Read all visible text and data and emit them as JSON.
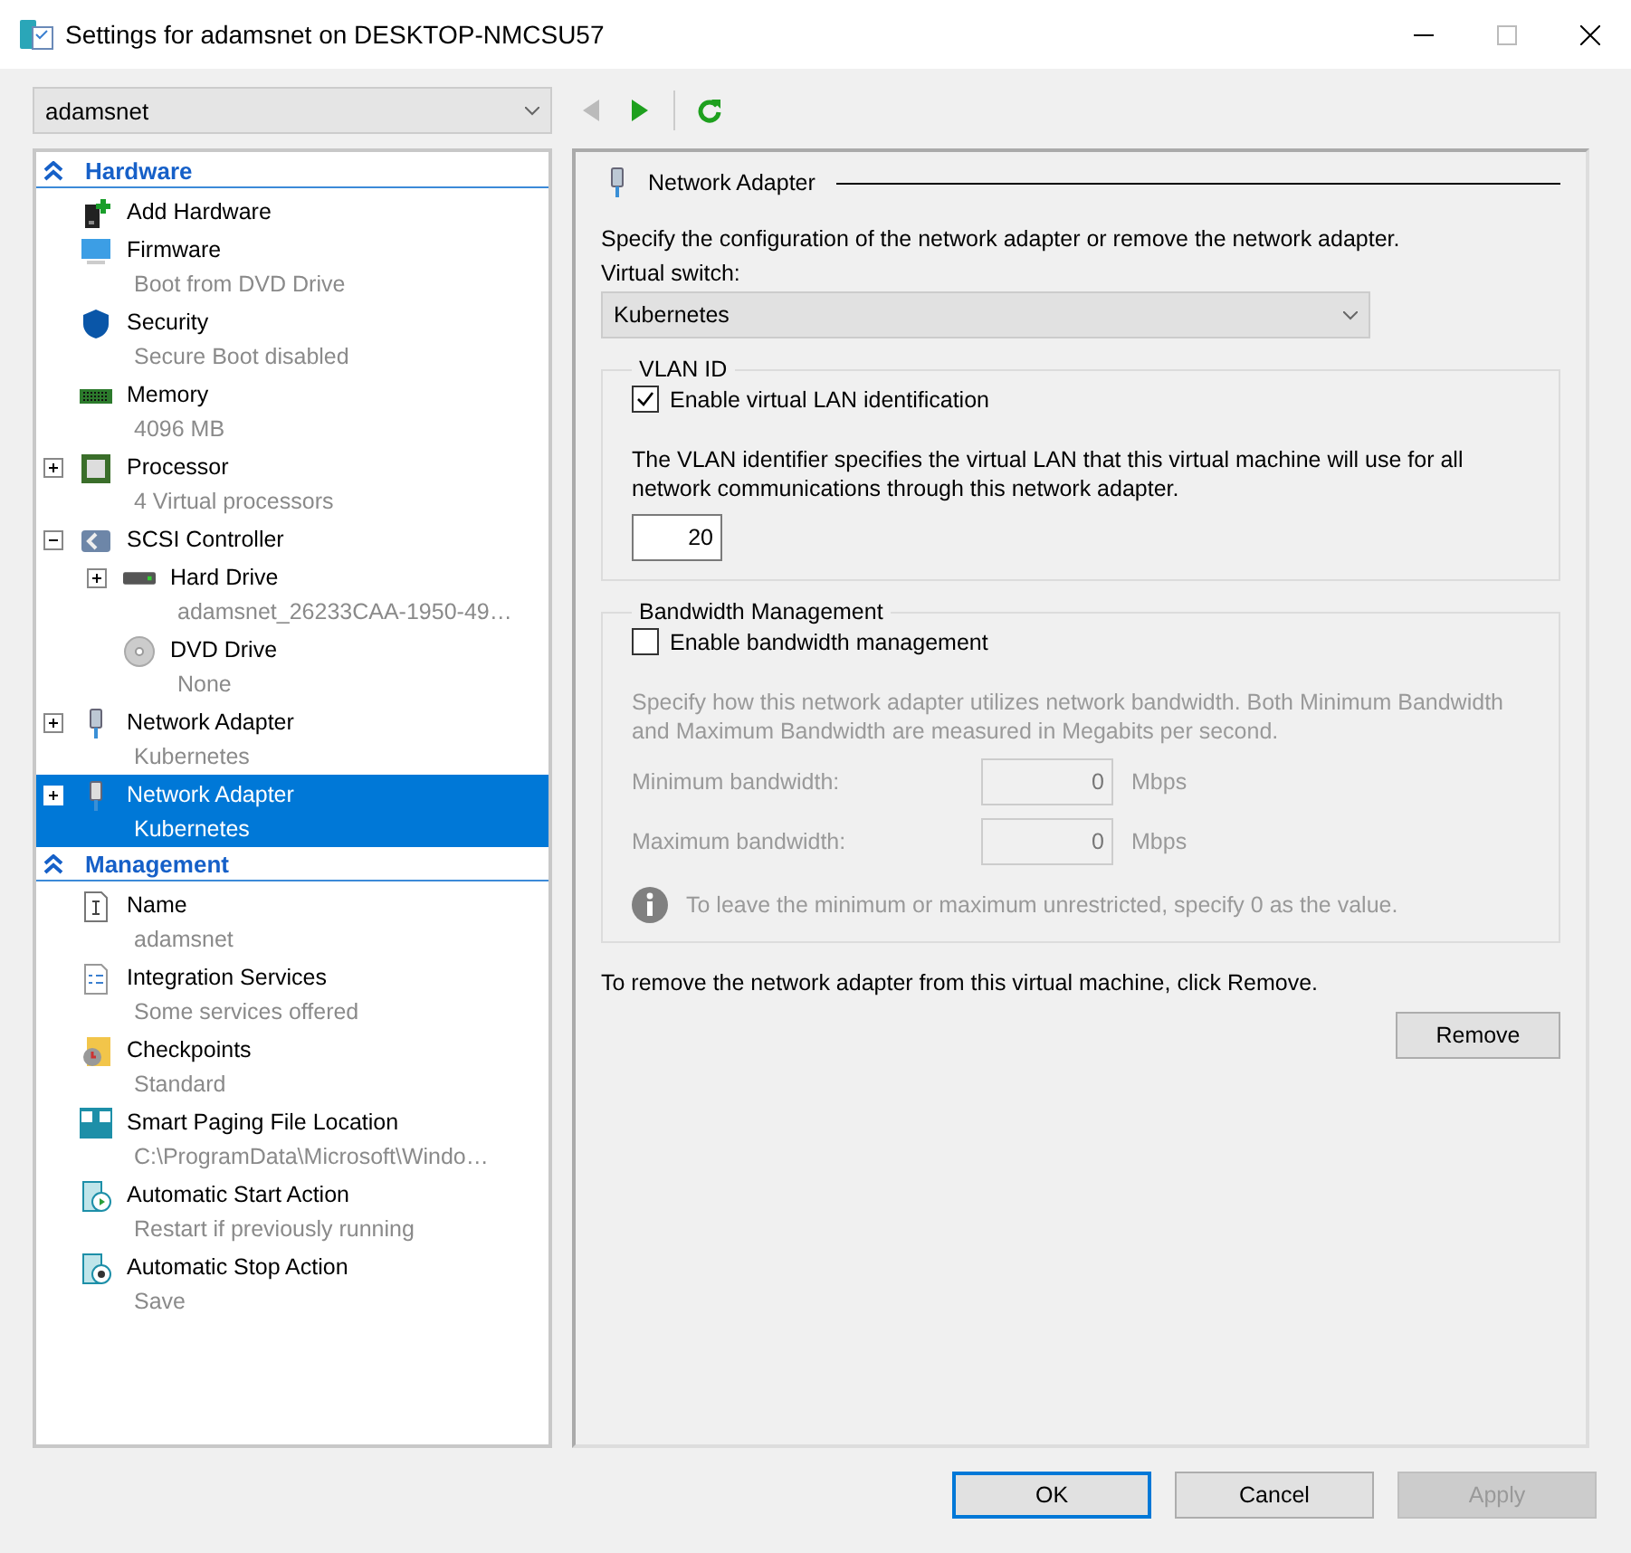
{
  "window": {
    "title": "Settings for adamsnet on DESKTOP-NMCSU57"
  },
  "vm_selector": {
    "value": "adamsnet"
  },
  "tree": [
    {
      "title": "Hardware",
      "items": [
        {
          "name": "Add Hardware",
          "kind": "add-hardware",
          "selected": false
        },
        {
          "name": "Firmware",
          "detail": "Boot from DVD Drive",
          "kind": "firmware",
          "selected": false
        },
        {
          "name": "Security",
          "detail": "Secure Boot disabled",
          "kind": "security",
          "selected": false
        },
        {
          "name": "Memory",
          "detail": "4096 MB",
          "kind": "memory",
          "selected": false
        },
        {
          "name": "Processor",
          "detail": "4 Virtual processors",
          "kind": "processor",
          "expanded": false,
          "selected": false
        },
        {
          "name": "SCSI Controller",
          "kind": "controller",
          "expanded": true,
          "selected": false,
          "children": [
            {
              "name": "Hard Drive",
              "detail": "adamsnet_26233CAA-1950-49…",
              "kind": "disk",
              "expanded": false,
              "selected": false
            },
            {
              "name": "DVD Drive",
              "detail": "None",
              "kind": "dvd",
              "selected": false
            }
          ]
        },
        {
          "name": "Network Adapter",
          "detail": "Kubernetes",
          "kind": "network",
          "expanded": false,
          "selected": false
        },
        {
          "name": "Network Adapter",
          "detail": "Kubernetes",
          "kind": "network",
          "expanded": false,
          "selected": true
        }
      ]
    },
    {
      "title": "Management",
      "items": [
        {
          "name": "Name",
          "detail": "adamsnet",
          "kind": "name",
          "selected": false
        },
        {
          "name": "Integration Services",
          "detail": "Some services offered",
          "kind": "services",
          "selected": false
        },
        {
          "name": "Checkpoints",
          "detail": "Standard",
          "kind": "checkpoints",
          "selected": false
        },
        {
          "name": "Smart Paging File Location",
          "detail": "C:\\ProgramData\\Microsoft\\Windo…",
          "kind": "paging",
          "selected": false
        },
        {
          "name": "Automatic Start Action",
          "detail": "Restart if previously running",
          "kind": "start",
          "selected": false
        },
        {
          "name": "Automatic Stop Action",
          "detail": "Save",
          "kind": "stop",
          "selected": false
        }
      ]
    }
  ],
  "panel": {
    "title": "Network Adapter",
    "description": "Specify the configuration of the network adapter or remove the network adapter.",
    "virtual_switch": {
      "label": "Virtual switch:",
      "value": "Kubernetes"
    },
    "vlan": {
      "legend": "VLAN ID",
      "checkbox": {
        "label": "Enable virtual LAN identification",
        "checked": true
      },
      "description": "The VLAN identifier specifies the virtual LAN that this virtual machine will use for all network communications through this network adapter.",
      "value": "20"
    },
    "bandwidth": {
      "legend": "Bandwidth Management",
      "checkbox": {
        "label": "Enable bandwidth management",
        "checked": false
      },
      "description": "Specify how this network adapter utilizes network bandwidth. Both Minimum Bandwidth and Maximum Bandwidth are measured in Megabits per second.",
      "fields": [
        {
          "label": "Minimum bandwidth:",
          "value": "0",
          "unit": "Mbps"
        },
        {
          "label": "Maximum bandwidth:",
          "value": "0",
          "unit": "Mbps"
        }
      ],
      "note": "To leave the minimum or maximum unrestricted, specify 0 as the value."
    },
    "remove_text": "To remove the network adapter from this virtual machine, click Remove.",
    "remove_button": "Remove"
  },
  "buttons": [
    {
      "label": "OK",
      "default": true,
      "disabled": false
    },
    {
      "label": "Cancel",
      "default": false,
      "disabled": false
    },
    {
      "label": "Apply",
      "default": false,
      "disabled": true
    }
  ]
}
